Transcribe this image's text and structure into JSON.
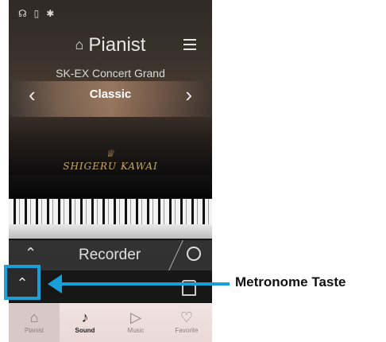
{
  "status_icons": [
    "headphone-icon",
    "usb-icon",
    "bluetooth-icon"
  ],
  "header": {
    "title": "Pianist",
    "model": "SK-EX Concert Grand"
  },
  "genre": {
    "label": "Classic"
  },
  "brand": {
    "text": "SHIGERU KAWAI"
  },
  "recorder": {
    "label": "Recorder"
  },
  "tabs": [
    {
      "label": "Pianist",
      "icon": "piano-icon"
    },
    {
      "label": "Sound",
      "icon": "music-note-icon"
    },
    {
      "label": "Music",
      "icon": "play-icon"
    },
    {
      "label": "Favorite",
      "icon": "heart-icon"
    }
  ],
  "callout": {
    "label": "Metronome Taste"
  },
  "colors": {
    "accent": "#1aa0d8"
  }
}
